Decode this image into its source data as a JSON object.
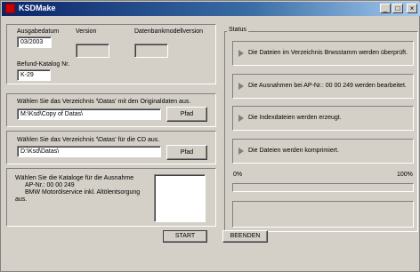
{
  "window": {
    "title": "KSDMake",
    "minimize": "_",
    "maximize": "□",
    "close": "×"
  },
  "details": {
    "ausgabedatum_label": "Ausgabedatum",
    "ausgabedatum_value": "03/2003",
    "version_label": "Version",
    "version_value": "",
    "datenbank_label": "Datenbankmodellversion",
    "datenbank_value": "",
    "befund_label": "Befund-Katalog Nr.",
    "befund_value": "K-29"
  },
  "source": {
    "label": "Wählen Sie das Verzeichnis '\\Datas' mit den Originaldaten aus.",
    "path_value": "M:\\Ksd\\Copy of Datas\\",
    "button_label": "Pfad"
  },
  "target": {
    "label": "Wählen Sie das Verzeichnis '\\Datas' für die CD aus.",
    "path_value": "D:\\Ksd\\Datas\\",
    "button_label": "Pfad"
  },
  "catalogs": {
    "label_line1": "Wählen Sie die Kataloge für die Ausnahme",
    "label_line2": "AP-Nr.: 00 00 249",
    "label_line3": "BMW Motorölservice inkl. Altölentsorgung",
    "label_line4": "aus."
  },
  "status": {
    "group_label": "Status",
    "items": [
      "Die Dateien im Verzeichnis Brwsstamm werden überprüft.",
      "Die Ausnahmen bei AP-Nr.: 00 00 249 werden bearbeitet.",
      "Die Indexdateien werden erzeugt.",
      "Die Dateien werden komprimiert."
    ],
    "progress_min": "0%",
    "progress_max": "100%",
    "progress_fraction": 0
  },
  "footer": {
    "start_label": "START",
    "end_label": "BEENDEN"
  }
}
